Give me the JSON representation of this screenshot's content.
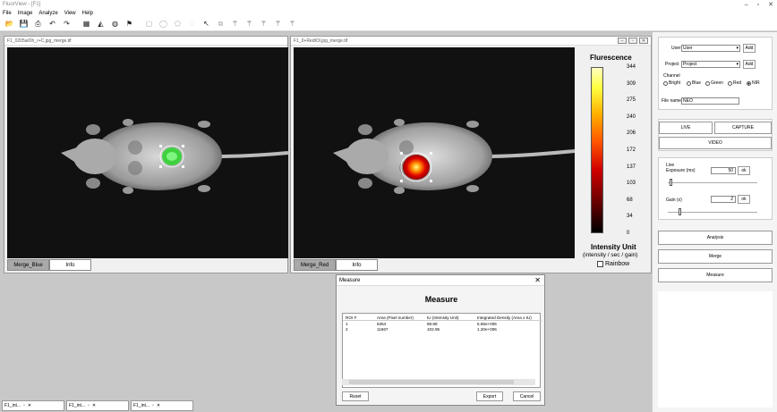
{
  "app": {
    "title": "FluorView - [F1]",
    "menu": [
      "File",
      "Image",
      "Analyze",
      "View",
      "Help"
    ]
  },
  "toolbar_icons": [
    "open-icon",
    "save-icon",
    "print-icon",
    "undo-icon",
    "redo-icon",
    "gallery-icon",
    "chart-icon",
    "globe-icon",
    "flag-icon",
    "rect-roi-icon",
    "ellipse-roi-icon",
    "polygon-roi-icon",
    "freehand-roi-icon",
    "pointer-icon",
    "copy-icon",
    "wand-icon",
    "wand-icon",
    "wand-icon",
    "wand-icon",
    "wand-icon"
  ],
  "windows": {
    "left": {
      "title": "F1_0205aiOh_r+C.jpg_merge.tif",
      "tabs": [
        "Merge_Blue",
        "Info"
      ]
    },
    "right": {
      "title": "F1_0+RedtOl.jpg_merge.tif",
      "tabs": [
        "Merge_Red",
        "Info"
      ],
      "legend": {
        "title": "Flurescence",
        "ticks": [
          "344",
          "309",
          "275",
          "240",
          "206",
          "172",
          "137",
          "103",
          "68",
          "34",
          "0"
        ],
        "unit": "Intensity Unit",
        "unit_sub": "(intensity / sec / gain)",
        "rainbow_label": "Rainbow"
      }
    }
  },
  "panel": {
    "user_label": "User",
    "user_value": "User",
    "project_label": "Project",
    "project_value": "Project",
    "add_label": "Add",
    "channel_label": "Channel",
    "channels": [
      "Bright",
      "Blue",
      "Green",
      "Red",
      "NIR"
    ],
    "selected_channel": "NIR",
    "filename_label": "File name",
    "filename_value": "NEO",
    "live_label": "LIVE",
    "capture_label": "CAPTURE",
    "video_label": "VIDEO",
    "live_section": "Live",
    "exposure_label": "Exposure (ms)",
    "exposure_value": "50",
    "gain_label": "Gain (x)",
    "gain_value": "2",
    "ok_label": "ok",
    "analysis_label": "Analysis",
    "merge_label": "Merge",
    "measure_label": "Measure"
  },
  "measure": {
    "window_title": "Measure",
    "heading": "Measure",
    "columns": [
      "ROI #",
      "Area (Pixel number)",
      "IU (Intensity Unit)",
      "Integrated Density (Area x IU)"
    ],
    "rows": [
      [
        "1",
        "6354",
        "88.88",
        "5.65e+005"
      ],
      [
        "2",
        "11667",
        "102.95",
        "1.20e+006"
      ]
    ],
    "reset_label": "Reset",
    "export_label": "Export",
    "cancel_label": "Cancel"
  },
  "minimized": [
    "F1_int...",
    "F1_int...",
    "F1_int..."
  ]
}
